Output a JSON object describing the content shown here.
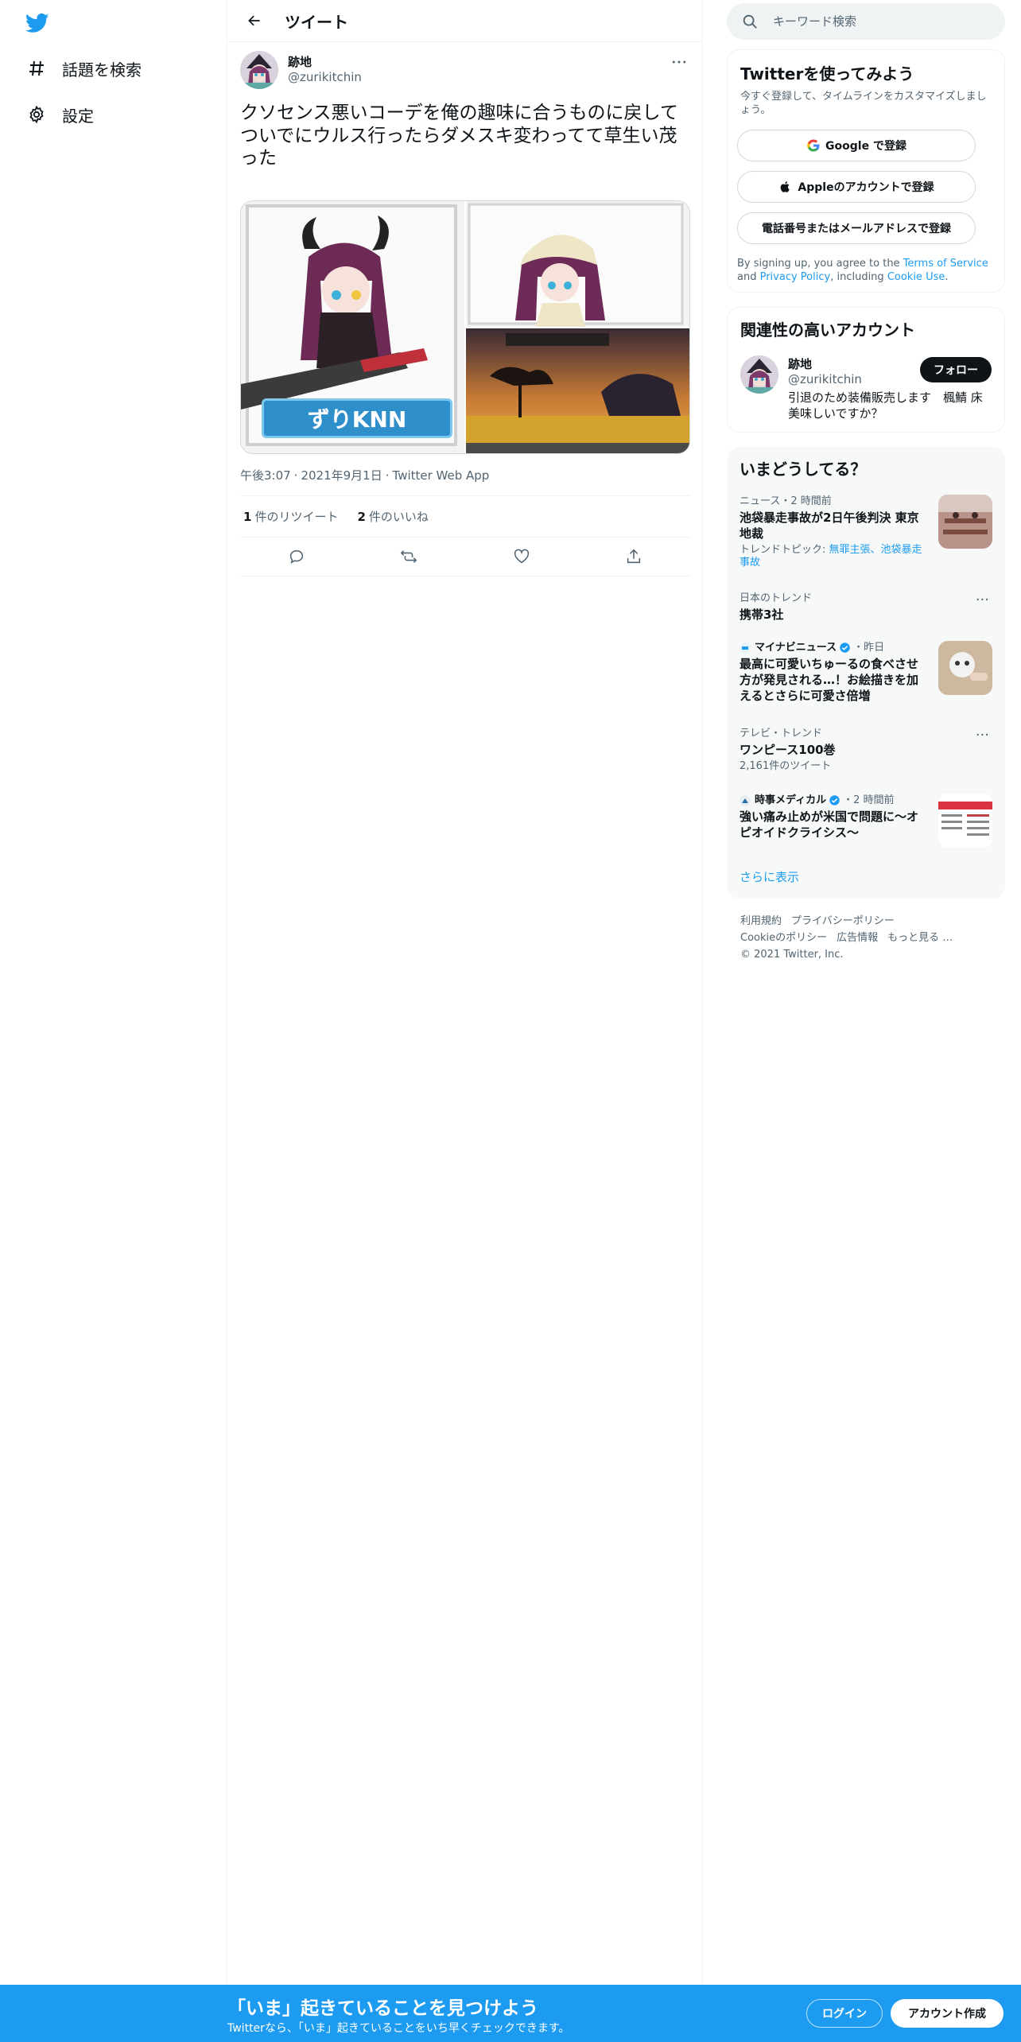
{
  "colors": {
    "accent": "#1d9bf0",
    "text": "#0f1419",
    "secondary": "#536471",
    "border": "#eff3f4",
    "panel": "#f7f9f9"
  },
  "nav": {
    "logo_icon": "twitter-bird-icon",
    "items": [
      {
        "icon": "hashtag-icon",
        "label": "話題を検索"
      },
      {
        "icon": "gear-icon",
        "label": "設定"
      }
    ]
  },
  "header": {
    "back_icon": "arrow-left-icon",
    "title": "ツイート"
  },
  "tweet": {
    "author_name": "跡地",
    "author_handle": "@zurikitchin",
    "text": "クソセンス悪いコーデを俺の趣味に合うものに戻して\nついでにウルス行ったらダメスキ変わってて草生い茂った",
    "media_overlay_text": "ずりKNN",
    "time": "午後3:07",
    "date": "2021年9月1日",
    "client": "Twitter Web App",
    "retweets_count": "1",
    "retweets_label": "件のリツイート",
    "likes_count": "2",
    "likes_label": "件のいいね",
    "action_icons": [
      "reply-icon",
      "retweet-icon",
      "like-icon",
      "share-icon"
    ]
  },
  "search": {
    "placeholder": "キーワード検索"
  },
  "signup_card": {
    "title": "Twitterを使ってみよう",
    "subtitle": "今すぐ登録して、タイムラインをカスタマイズしましょう。",
    "google_button": "Google で登録",
    "apple_button": "Appleのアカウントで登録",
    "phone_button": "電話番号またはメールアドレスで登録",
    "legal_prefix": "By signing up, you agree to the ",
    "terms": "Terms of Service",
    "legal_and": " and ",
    "privacy": "Privacy Policy",
    "legal_including": ", including ",
    "cookie": "Cookie Use",
    "legal_end": "."
  },
  "related": {
    "title": "関連性の高いアカウント",
    "name": "跡地",
    "handle": "@zurikitchin",
    "bio": "引退のため装備販売します　楓鯖 床美味しいですか？",
    "follow_button": "フォロー"
  },
  "trends": {
    "title": "いまどうしてる？",
    "items": [
      {
        "context": "ニュース・2 時間前",
        "title": "池袋暴走事故が2日午後判決 東京地裁",
        "topic_prefix": "トレンドトピック: ",
        "topic_links": "無罪主張、池袋暴走事故"
      },
      {
        "context": "日本のトレンド",
        "title": "携帯3社"
      },
      {
        "source": "マイナビニュース",
        "time": "・昨日",
        "title": "最高に可愛いちゅーるの食べさせ方が発見される…！お絵描きを加えるとさらに可愛さ倍増"
      },
      {
        "context": "テレビ・トレンド",
        "title": "ワンピース100巻",
        "tweets": "2,161件のツイート"
      },
      {
        "source": "時事メディカル",
        "time": "・2 時間前",
        "title": "強い痛み止めが米国で問題に～オピオイドクライシス～"
      }
    ],
    "show_more": "さらに表示"
  },
  "footer": {
    "links": [
      "利用規約",
      "プライバシーポリシー",
      "Cookieのポリシー",
      "広告情報",
      "もっと見る …"
    ],
    "copyright": "© 2021 Twitter, Inc."
  },
  "bottom_bar": {
    "title": "「いま」起きていることを見つけよう",
    "subtitle": "Twitterなら、「いま」起きていることをいち早くチェックできます。",
    "login": "ログイン",
    "signup": "アカウント作成"
  }
}
